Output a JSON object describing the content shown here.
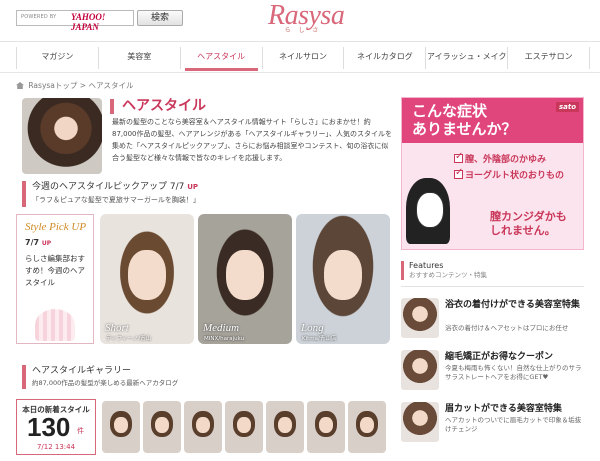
{
  "header": {
    "search_powered": "POWERED BY",
    "search_brand": "YAHOO! JAPAN",
    "search_button": "検索",
    "logo": "Rasysa",
    "logo_sub": "ら し さ"
  },
  "nav": [
    "マガジン",
    "美容室",
    "ヘアスタイル",
    "ネイルサロン",
    "ネイルカタログ",
    "アイラッシュ・メイク",
    "エステサロン"
  ],
  "breadcrumb": {
    "home": "Rasysaトップ",
    "sep": ">",
    "current": "ヘアスタイル"
  },
  "page": {
    "title": "ヘアスタイル",
    "desc": "最新の髪型のことなら美容室＆ヘアスタイル情報サイト「らしさ」におまかせ！約87,000作品の髪型、ヘアアレンジがある「ヘアスタイルギャラリー」、人気のスタイルを集めた「ヘアスタイルピックアップ」、さらにお悩み相談室やコンテスト、旬の浴衣に似合う髪型など様々な情報で皆なのキレイを応援します。"
  },
  "pickup": {
    "title": "今週のヘアスタイルピックアップ 7/7",
    "up": "UP",
    "subtitle": "「ラフ＆ピュアな髪型で夏旅サマーガールを胸装！」",
    "card_title": "Style Pick UP",
    "card_date": "7/7",
    "card_up": "UP",
    "card_text": "らしさ編集部おすすめ！今週のヘアスタイル",
    "photos": [
      {
        "label": "Short",
        "credit": "ティフィーノ/青山"
      },
      {
        "label": "Medium",
        "credit": "MINX/harajuku"
      },
      {
        "label": "Long",
        "credit": "Kitma/青山店"
      }
    ]
  },
  "gallery": {
    "title": "ヘアスタイルギャラリー",
    "subtitle": "約87,000作品の髪型が楽しめる最新ヘアカタログ",
    "new_label": "本日の新着スタイル",
    "new_count": "130",
    "new_unit": "件",
    "new_time": "7/12 13:44"
  },
  "ad": {
    "logo": "sato",
    "headline_1": "こんな症状",
    "headline_2": "ありませんか？",
    "item_1": "膣、外陰部のかゆみ",
    "item_2": "ヨーグルト状のおりもの",
    "bottom_1": "膣カンジダかも",
    "bottom_2": "しれません。"
  },
  "features": {
    "title": "Features",
    "subtitle": "おすすめコンテンツ・特集",
    "items": [
      {
        "title": "浴衣の着付けができる美容室特集",
        "desc": "浴衣の着付け＆ヘアセットはプロにお任せ"
      },
      {
        "title": "縮毛矯正がお得なクーポン",
        "desc": "今夏も梅雨も怖くない！自然な仕上がりのサラサラストレートヘアをお得にGET♥"
      },
      {
        "title": "眉カットができる美容室特集",
        "desc": "ヘアカットのついでに眉毛カットで印象＆垢抜けチェンジ"
      }
    ]
  }
}
